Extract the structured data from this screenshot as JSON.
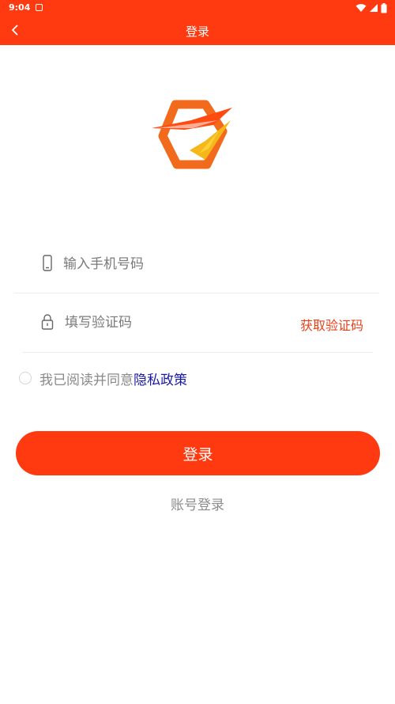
{
  "status_bar": {
    "time": "9:04",
    "icons": [
      "notification-icon",
      "wifi-icon",
      "signal-icon",
      "battery-icon"
    ]
  },
  "header": {
    "title": "登录",
    "back_icon": "back-arrow-icon"
  },
  "form": {
    "phone": {
      "placeholder": "输入手机号码",
      "value": "",
      "icon": "phone-icon"
    },
    "code": {
      "placeholder": "填写验证码",
      "value": "",
      "icon": "lock-icon"
    },
    "get_code_label": "获取验证码"
  },
  "agreement": {
    "text": "我已阅读并同意",
    "link": "隐私政策",
    "checked": false
  },
  "login_button": "登录",
  "account_login": "账号登录",
  "colors": {
    "primary": "#ff3a10",
    "link": "#1a1aa6",
    "placeholder": "#7a7a7a",
    "logo_orange": "#f26a1b",
    "logo_yellow": "#f5b818"
  }
}
